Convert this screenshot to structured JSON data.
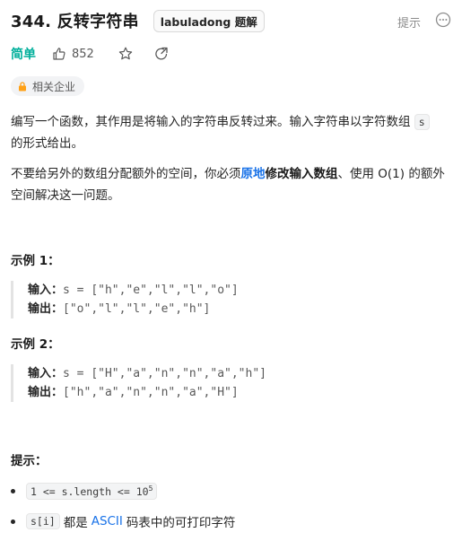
{
  "header": {
    "title": "344. 反转字符串",
    "badge": "labuladong 题解",
    "hint_label": "提示",
    "more_icon": "more-circle-icon"
  },
  "meta": {
    "difficulty": "简单",
    "likes": "852",
    "like_icon": "thumbs-up-icon",
    "favorite_icon": "star-icon",
    "share_icon": "share-icon"
  },
  "company": {
    "label": "相关企业",
    "icon": "lock-icon"
  },
  "description": {
    "p1_text": "编写一个函数，其作用是将输入的字符串反转过来。输入字符串以字符数组",
    "p1_code": "s",
    "p1_tail": "的形式给出。",
    "p2_a": "不要给另外的数组分配额外的空间，你必须",
    "p2_link": "原地",
    "p2_bold": "修改输入数组",
    "p2_b": "、使用 O(1) 的额外空间解决这一问题。"
  },
  "examples": [
    {
      "title": "示例 1：",
      "input_label": "输入：",
      "input": "s = [\"h\",\"e\",\"l\",\"l\",\"o\"]",
      "output_label": "输出：",
      "output": "[\"o\",\"l\",\"l\",\"e\",\"h\"]"
    },
    {
      "title": "示例 2：",
      "input_label": "输入：",
      "input": "s = [\"H\",\"a\",\"n\",\"n\",\"a\",\"h\"]",
      "output_label": "输出：",
      "output": "[\"h\",\"a\",\"n\",\"n\",\"a\",\"H\"]"
    }
  ],
  "tips": {
    "title": "提示：",
    "tip1_code": "1 <= s.length <= 10",
    "tip1_sup": "5",
    "tip2_code": "s[i]",
    "tip2_a": "都是",
    "tip2_link": "ASCII",
    "tip2_b": "码表中的可打印字符"
  },
  "colors": {
    "easy": "#00af9b",
    "link": "#1a73e8"
  }
}
